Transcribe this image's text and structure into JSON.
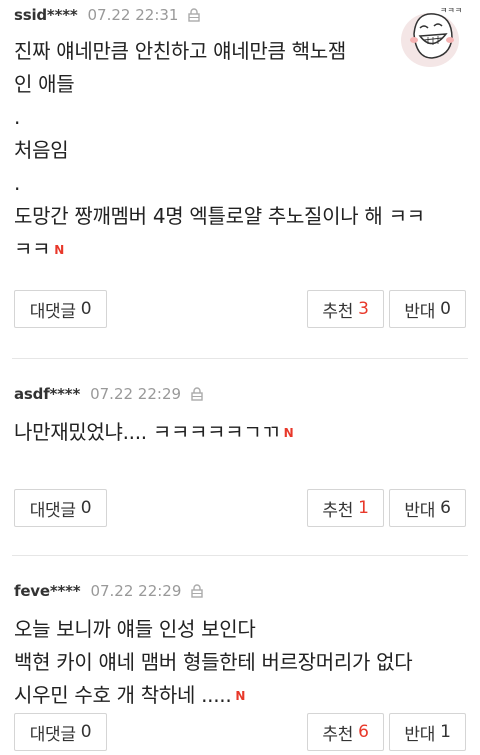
{
  "comments": [
    {
      "author": "ssid****",
      "time": "07.22 22:31",
      "lines": [
        "진짜 얘네만큼 안친하고 얘네만큼 핵노잼",
        "인 애들",
        ".",
        "처음임",
        ".",
        "도망간 짱깨멤버 4명 엑틀로얄 추노질이나 해 ㅋㅋ",
        "ㅋㅋ"
      ],
      "reply_label": "대댓글",
      "reply_count": "0",
      "recommend_label": "추천",
      "recommend_count": "3",
      "oppose_label": "반대",
      "oppose_count": "0"
    },
    {
      "author": "asdf****",
      "time": "07.22 22:29",
      "lines": [
        "나만재밌었냐.... ㅋㅋㅋㅋㅋㄱㄲ"
      ],
      "reply_label": "대댓글",
      "reply_count": "0",
      "recommend_label": "추천",
      "recommend_count": "1",
      "oppose_label": "반대",
      "oppose_count": "6"
    },
    {
      "author": "feve****",
      "time": "07.22 22:29",
      "lines": [
        "오늘 보니까 얘들 인성 보인다",
        "백현 카이 얘네 맴버 형들한테 버르장머리가 없다",
        "시우민 수호 개 착하네 ....."
      ],
      "reply_label": "대댓글",
      "reply_count": "0",
      "recommend_label": "추천",
      "recommend_count": "6",
      "oppose_label": "반대",
      "oppose_count": "1"
    }
  ],
  "new_badge": "N",
  "colors": {
    "accent_red": "#e8382a",
    "meta_gray": "#999999",
    "border": "#d5d5d5"
  },
  "icons": {
    "lock": "lock-icon",
    "avatar": "laughing-avatar-icon"
  }
}
